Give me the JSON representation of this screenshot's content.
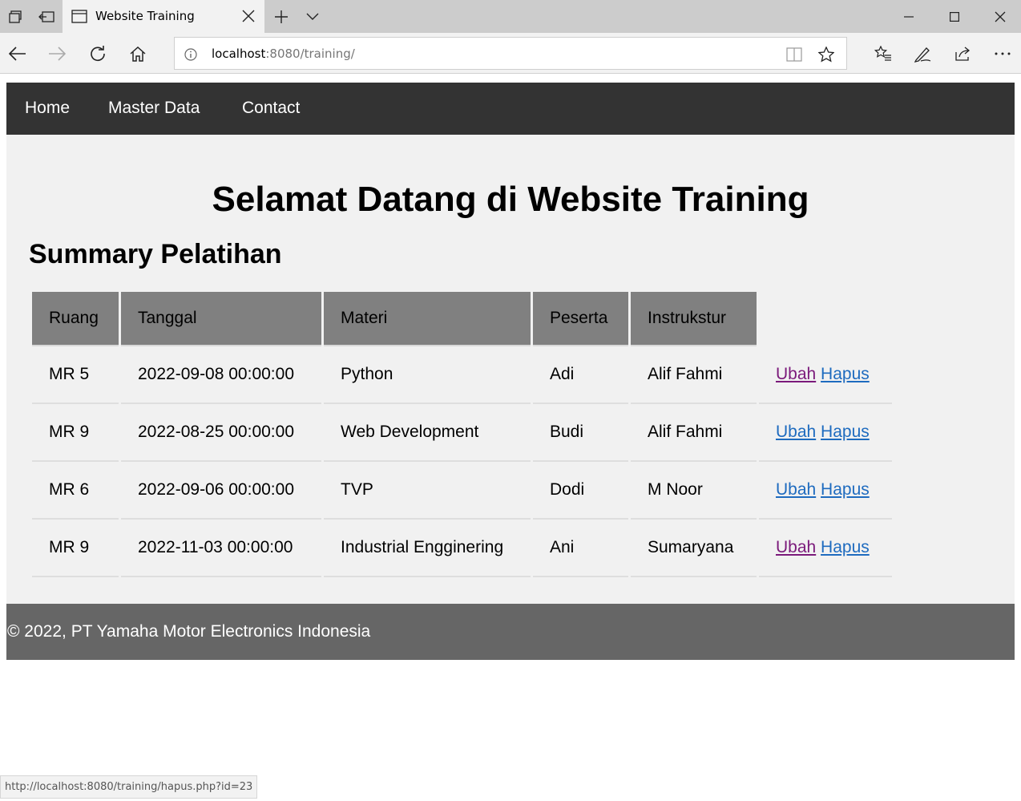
{
  "browser": {
    "tab_title": "Website Training",
    "address": {
      "host": "localhost",
      "path": ":8080/training/"
    },
    "status_url": "http://localhost:8080/training/hapus.php?id=23"
  },
  "nav": {
    "items": [
      {
        "label": "Home"
      },
      {
        "label": "Master Data"
      },
      {
        "label": "Contact"
      }
    ]
  },
  "page": {
    "title": "Selamat Datang di Website Training",
    "subtitle": "Summary Pelatihan"
  },
  "table": {
    "headers": [
      "Ruang",
      "Tanggal",
      "Materi",
      "Peserta",
      "Instrukstur"
    ],
    "rows": [
      {
        "ruang": "MR 5",
        "tanggal": "2022-09-08 00:00:00",
        "materi": "Python",
        "peserta": "Adi",
        "instruktur": "Alif Fahmi",
        "edit": "Ubah",
        "delete": "Hapus"
      },
      {
        "ruang": "MR 9",
        "tanggal": "2022-08-25 00:00:00",
        "materi": "Web Development",
        "peserta": "Budi",
        "instruktur": "Alif Fahmi",
        "edit": "Ubah",
        "delete": "Hapus"
      },
      {
        "ruang": "MR 6",
        "tanggal": "2022-09-06 00:00:00",
        "materi": "TVP",
        "peserta": "Dodi",
        "instruktur": "M Noor",
        "edit": "Ubah",
        "delete": "Hapus"
      },
      {
        "ruang": "MR 9",
        "tanggal": "2022-11-03 00:00:00",
        "materi": "Industrial Engginering",
        "peserta": "Ani",
        "instruktur": "Sumaryana",
        "edit": "Ubah",
        "delete": "Hapus"
      }
    ]
  },
  "footer": {
    "text": "© 2022, PT Yamaha Motor Electronics Indonesia"
  },
  "colors": {
    "menubar": "#333333",
    "content": "#f1f1f1",
    "header_cell": "#808080",
    "footer": "#666666",
    "link": "#1e6bbf",
    "visited_link": "#7b1a7b"
  }
}
